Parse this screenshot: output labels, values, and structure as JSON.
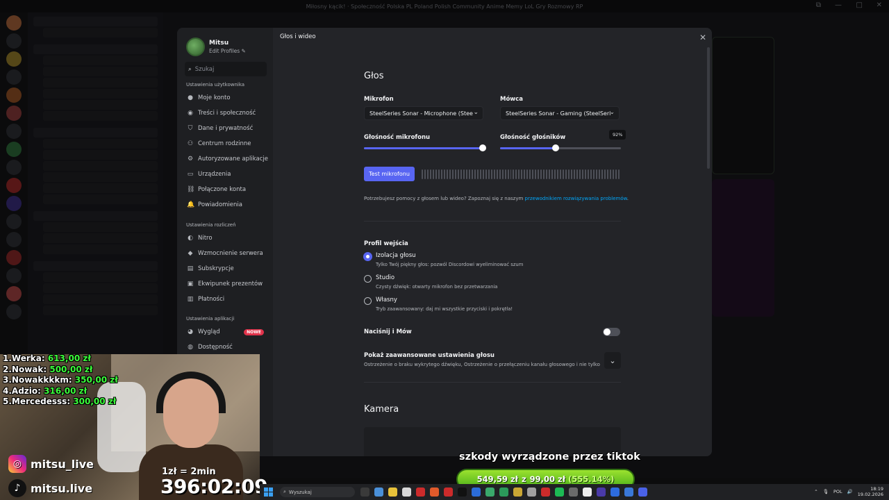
{
  "window": {
    "title": "Miłosny kącik! · Społeczność Polska PL Poland Polish Community Anime Memy LoL Gry Rozmowy RP",
    "controls": [
      "⧉",
      "—",
      "□",
      "✕"
    ]
  },
  "settings": {
    "profile": {
      "name": "Mitsu",
      "edit_label": "Edit Profiles"
    },
    "search_placeholder": "Szukaj",
    "user_section_title": "Ustawienia użytkownika",
    "user_items": [
      {
        "label": "Moje konto",
        "icon": "user-icon"
      },
      {
        "label": "Treści i społeczność",
        "icon": "community-icon"
      },
      {
        "label": "Dane i prywatność",
        "icon": "shield-icon"
      },
      {
        "label": "Centrum rodzinne",
        "icon": "family-icon"
      },
      {
        "label": "Autoryzowane aplikacje",
        "icon": "apps-icon"
      },
      {
        "label": "Urządzenia",
        "icon": "devices-icon"
      },
      {
        "label": "Połączone konta",
        "icon": "link-icon"
      },
      {
        "label": "Powiadomienia",
        "icon": "bell-icon"
      }
    ],
    "billing_section_title": "Ustawienia rozliczeń",
    "billing_items": [
      {
        "label": "Nitro",
        "icon": "nitro-icon"
      },
      {
        "label": "Wzmocnienie serwera",
        "icon": "boost-icon"
      },
      {
        "label": "Subskrypcje",
        "icon": "subscription-icon"
      },
      {
        "label": "Ekwipunek prezentów",
        "icon": "gift-icon"
      },
      {
        "label": "Płatności",
        "icon": "payment-icon"
      }
    ],
    "app_section_title": "Ustawienia aplikacji",
    "app_items": [
      {
        "label": "Wygląd",
        "icon": "palette-icon",
        "badge": "NOWE"
      },
      {
        "label": "Dostępność",
        "icon": "accessibility-icon"
      }
    ],
    "pane_title": "Głos i wideo",
    "voice": {
      "heading": "Głos",
      "mic_label": "Mikrofon",
      "mic_value": "SteelSeries Sonar - Microphone (Stee",
      "speaker_label": "Mówca",
      "speaker_value": "SteelSeries Sonar - Gaming (SteelSeri",
      "mic_volume_label": "Głośność mikrofonu",
      "mic_volume": 1.0,
      "speaker_volume_label": "Głośność głośników",
      "speaker_volume": 0.46,
      "speaker_volume_tooltip": "92%",
      "test_button": "Test mikrofonu",
      "help_text": "Potrzebujesz pomocy z głosem lub wideo? Zapoznaj się z naszym",
      "help_link": "przewodnikiem rozwiązywania problemów",
      "help_end": "."
    },
    "input_profile": {
      "title": "Profil wejścia",
      "options": [
        {
          "title": "Izolacja głosu",
          "desc": "Tylko Twój piękny głos: pozwól Discordowi wyeliminować szum",
          "selected": true
        },
        {
          "title": "Studio",
          "desc": "Czysty dźwięk: otwarty mikrofon bez przetwarzania",
          "selected": false
        },
        {
          "title": "Własny",
          "desc": "Tryb zaawansowany: daj mi wszystkie przyciski i pokrętła!",
          "selected": false
        }
      ]
    },
    "ptt_label": "Naciśnij i Mów",
    "advanced_title": "Pokaż zaawansowane ustawienia głosu",
    "advanced_desc": "Ostrzeżenie o braku wykrytego dźwięku, Ostrzeżenie o przełączeniu kanału głosowego i nie tylko",
    "camera_heading": "Kamera"
  },
  "stream": {
    "leaderboard": [
      {
        "rank": "1.",
        "name": "Werka:",
        "amount": "613,00 zł"
      },
      {
        "rank": "2.",
        "name": "Nowak:",
        "amount": "500,00 zł"
      },
      {
        "rank": "3.",
        "name": "Nowakkkkm:",
        "amount": "350,00 zł"
      },
      {
        "rank": "4.",
        "name": "Adzio:",
        "amount": "316,00 zł"
      },
      {
        "rank": "5.",
        "name": "Mercedesss:",
        "amount": "300,00 zł"
      }
    ],
    "instagram": "mitsu_live",
    "tiktok": "mitsu.live",
    "rate": "1zł = 2min",
    "timer": "396:02:09",
    "goal_title": "szkody wyrządzone przez tiktok",
    "goal_current": "549,59 zł",
    "goal_sep": "z",
    "goal_target": "99,00 zł",
    "goal_pct": "(555.14%)"
  },
  "taskbar": {
    "search": "Wyszukaj",
    "lang": "POL",
    "time": "18:19",
    "date": "19.02.2026"
  }
}
